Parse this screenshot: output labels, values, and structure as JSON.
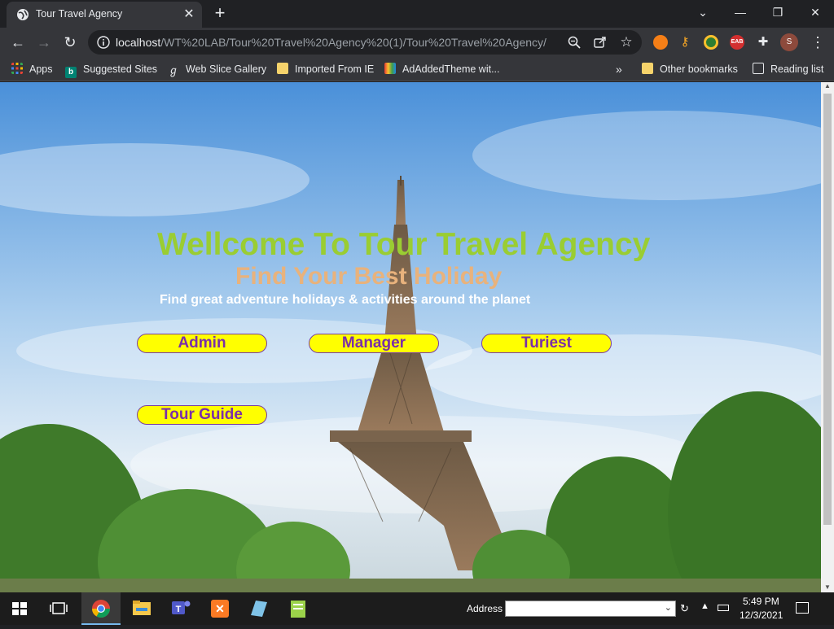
{
  "browser": {
    "tab_title": "Tour Travel Agency",
    "url_host": "localhost",
    "url_path": "/WT%20LAB/Tour%20Travel%20Agency%20(1)/Tour%20Travel%20Agency/",
    "profile_initial": "S"
  },
  "bookmarks": [
    {
      "label": "Apps",
      "icon": "apps-grid-icon"
    },
    {
      "label": "Suggested Sites",
      "icon": "bing-icon"
    },
    {
      "label": "Web Slice Gallery",
      "icon": "web-slice-icon"
    },
    {
      "label": "Imported From IE",
      "icon": "folder-icon"
    },
    {
      "label": "AdAddedTheme wit...",
      "icon": "theme-icon"
    }
  ],
  "bookmarks_right": {
    "overflow": "»",
    "other": "Other bookmarks",
    "reading_list": "Reading list"
  },
  "page": {
    "welcome": "Wellcome To Tour Travel Agency",
    "subtitle": "Find Your Best Holiday",
    "tagline": "Find great adventure holidays & activities around the planet",
    "buttons": {
      "admin": "Admin",
      "manager": "Manager",
      "tourist": "Turiest",
      "guide": "Tour Guide"
    },
    "colors": {
      "welcome": "#9acd32",
      "subtitle": "#e8b27c",
      "button_bg": "#ffff00",
      "button_text": "#7b2fa8"
    }
  },
  "taskbar": {
    "address_label": "Address",
    "time": "5:49 PM",
    "date": "12/3/2021"
  }
}
